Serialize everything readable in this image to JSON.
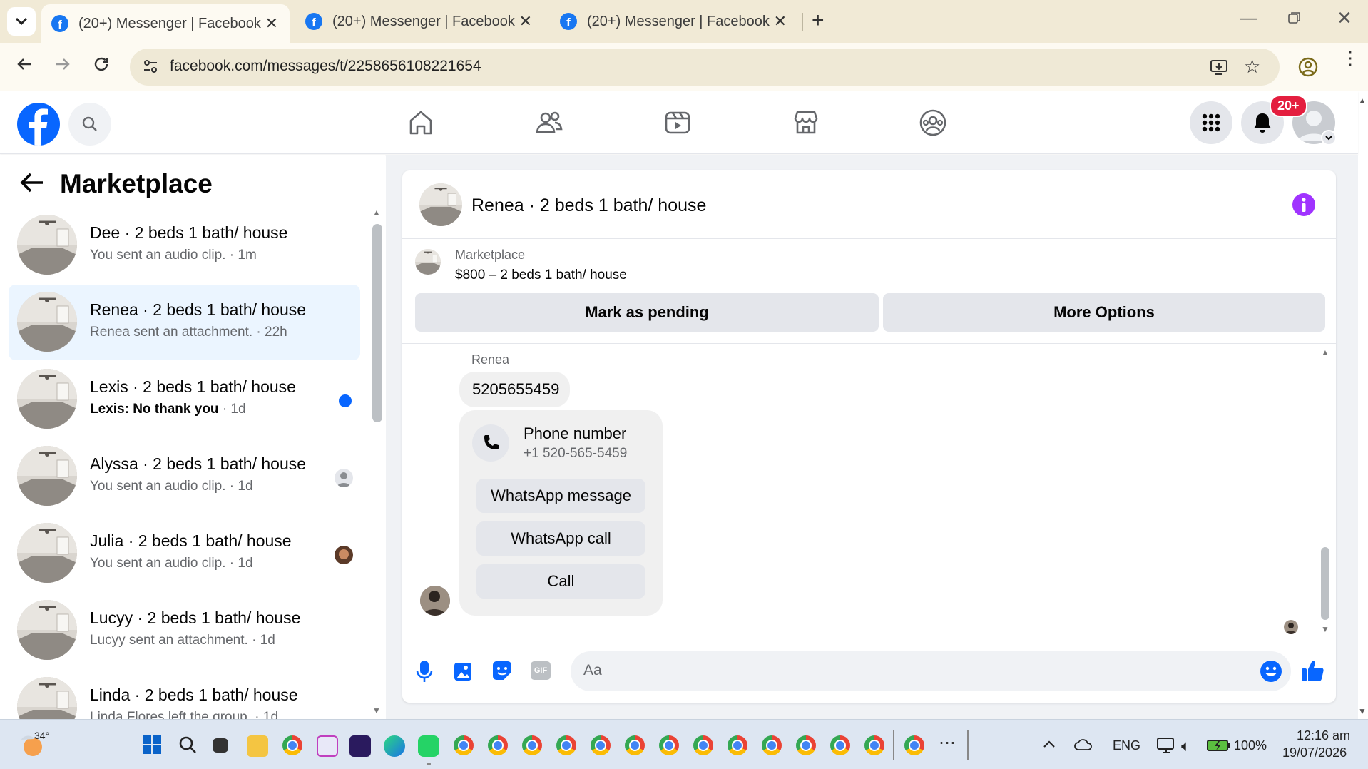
{
  "browser": {
    "tabs": [
      {
        "title": "(20+) Messenger | Facebook",
        "active": true
      },
      {
        "title": "(20+) Messenger | Facebook",
        "active": false
      },
      {
        "title": "(20+) Messenger | Facebook",
        "active": false
      }
    ],
    "url": "facebook.com/messages/t/2258656108221654"
  },
  "header": {
    "notification_badge": "20+"
  },
  "sidebar": {
    "title": "Marketplace",
    "conversations": [
      {
        "name": "Dee · 2 beds 1 bath/ house",
        "preview": "You sent an audio clip. · 1m",
        "selected": false,
        "unread": false
      },
      {
        "name": "Renea · 2 beds 1 bath/ house",
        "preview": "Renea sent an attachment. · 22h",
        "selected": true,
        "unread": false
      },
      {
        "name": "Lexis · 2 beds 1 bath/ house",
        "preview_bold": "Lexis: No thank you",
        "preview_time": " · 1d",
        "selected": false,
        "unread": true
      },
      {
        "name": "Alyssa · 2 beds 1 bath/ house",
        "preview": "You sent an audio clip. · 1d",
        "selected": false,
        "unread": false
      },
      {
        "name": "Julia · 2 beds 1 bath/ house",
        "preview": "You sent an audio clip. · 1d",
        "selected": false,
        "unread": false
      },
      {
        "name": "Lucyy · 2 beds 1 bath/ house",
        "preview": "Lucyy sent an attachment. · 1d",
        "selected": false,
        "unread": false
      },
      {
        "name": "Linda · 2 beds 1 bath/ house",
        "preview": "Linda Flores left the group. · 1d",
        "selected": false,
        "unread": false
      }
    ]
  },
  "chat": {
    "title": "Renea · 2 beds 1 bath/ house",
    "marketplace_label": "Marketplace",
    "listing": "$800 – 2 beds 1 bath/ house",
    "mark_pending_label": "Mark as pending",
    "more_options_label": "More Options",
    "sender_name": "Renea",
    "message_text": "5205655459",
    "phone_card": {
      "title": "Phone number",
      "number": "+1 520-565-5459",
      "whatsapp_message_label": "WhatsApp message",
      "whatsapp_call_label": "WhatsApp call",
      "call_label": "Call"
    },
    "composer_placeholder": "Aa",
    "gif_label": "GIF"
  },
  "taskbar": {
    "weather_temp": "34°",
    "language": "ENG",
    "battery": "100%",
    "time": "12:16 am",
    "date": "19/07/2026"
  },
  "colors": {
    "fb_blue": "#0866ff",
    "selected_row": "#ebf5ff",
    "notification_red": "#e41e3f",
    "info_purple": "#a033ff"
  }
}
